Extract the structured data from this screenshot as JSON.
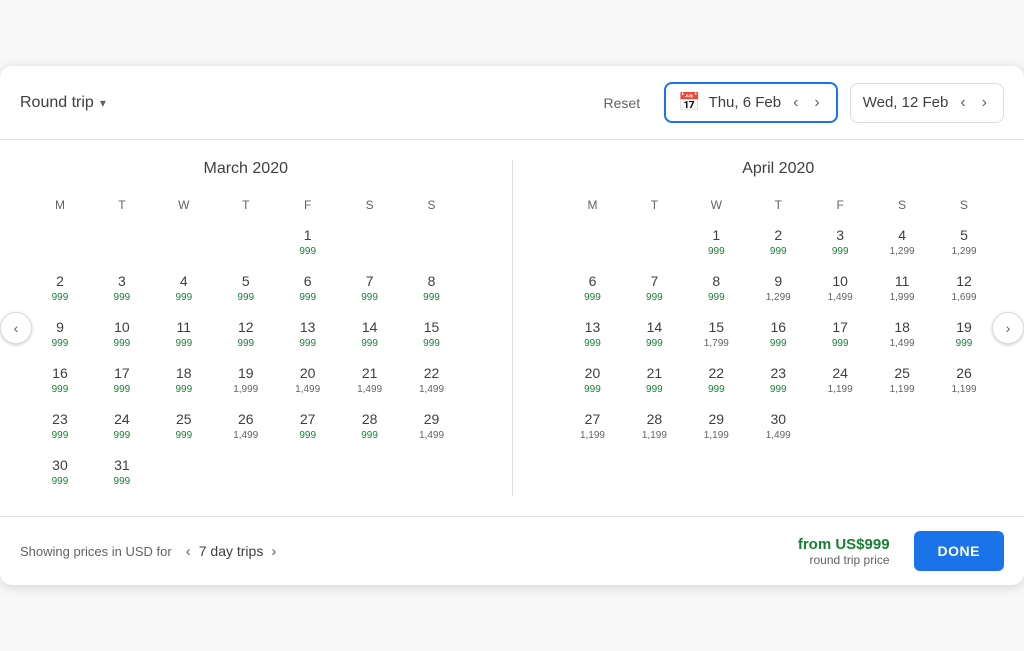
{
  "header": {
    "round_trip_label": "Round trip",
    "chevron_down": "▾",
    "reset_label": "Reset",
    "date1": {
      "icon": "📅",
      "text": "Thu, 6 Feb"
    },
    "date2": {
      "text": "Wed, 12 Feb"
    }
  },
  "left_calendar": {
    "title": "March 2020",
    "day_headers": [
      "M",
      "T",
      "W",
      "T",
      "F",
      "S",
      "S"
    ],
    "rows": [
      [
        {
          "num": "",
          "price": "",
          "green": false
        },
        {
          "num": "",
          "price": "",
          "green": false
        },
        {
          "num": "",
          "price": "",
          "green": false
        },
        {
          "num": "",
          "price": "",
          "green": false
        },
        {
          "num": "1",
          "price": "999",
          "green": true
        },
        {
          "num": "",
          "price": "",
          "green": false
        },
        {
          "num": "",
          "price": "",
          "green": false
        }
      ],
      [
        {
          "num": "2",
          "price": "999",
          "green": true
        },
        {
          "num": "3",
          "price": "999",
          "green": true
        },
        {
          "num": "4",
          "price": "999",
          "green": true
        },
        {
          "num": "5",
          "price": "999",
          "green": true
        },
        {
          "num": "6",
          "price": "999",
          "green": true
        },
        {
          "num": "7",
          "price": "999",
          "green": true
        },
        {
          "num": "8",
          "price": "999",
          "green": true
        }
      ],
      [
        {
          "num": "9",
          "price": "999",
          "green": true
        },
        {
          "num": "10",
          "price": "999",
          "green": true
        },
        {
          "num": "11",
          "price": "999",
          "green": true
        },
        {
          "num": "12",
          "price": "999",
          "green": true
        },
        {
          "num": "13",
          "price": "999",
          "green": true
        },
        {
          "num": "14",
          "price": "999",
          "green": true
        },
        {
          "num": "15",
          "price": "999",
          "green": true
        }
      ],
      [
        {
          "num": "16",
          "price": "999",
          "green": true
        },
        {
          "num": "17",
          "price": "999",
          "green": true
        },
        {
          "num": "18",
          "price": "999",
          "green": true
        },
        {
          "num": "19",
          "price": "1,999",
          "green": false
        },
        {
          "num": "20",
          "price": "1,499",
          "green": false
        },
        {
          "num": "21",
          "price": "1,499",
          "green": false
        },
        {
          "num": "22",
          "price": "1,499",
          "green": false
        }
      ],
      [
        {
          "num": "23",
          "price": "999",
          "green": true
        },
        {
          "num": "24",
          "price": "999",
          "green": true
        },
        {
          "num": "25",
          "price": "999",
          "green": true
        },
        {
          "num": "26",
          "price": "1,499",
          "green": false
        },
        {
          "num": "27",
          "price": "999",
          "green": true
        },
        {
          "num": "28",
          "price": "999",
          "green": true
        },
        {
          "num": "29",
          "price": "1,499",
          "green": false
        }
      ],
      [
        {
          "num": "30",
          "price": "999",
          "green": true
        },
        {
          "num": "31",
          "price": "999",
          "green": true
        },
        {
          "num": "",
          "price": "",
          "green": false
        },
        {
          "num": "",
          "price": "",
          "green": false
        },
        {
          "num": "",
          "price": "",
          "green": false
        },
        {
          "num": "",
          "price": "",
          "green": false
        },
        {
          "num": "",
          "price": "",
          "green": false
        }
      ]
    ]
  },
  "right_calendar": {
    "title": "April 2020",
    "day_headers": [
      "M",
      "T",
      "W",
      "T",
      "F",
      "S",
      "S"
    ],
    "rows": [
      [
        {
          "num": "",
          "price": "",
          "green": false
        },
        {
          "num": "",
          "price": "",
          "green": false
        },
        {
          "num": "1",
          "price": "999",
          "green": true
        },
        {
          "num": "2",
          "price": "999",
          "green": true
        },
        {
          "num": "3",
          "price": "999",
          "green": true
        },
        {
          "num": "4",
          "price": "1,299",
          "green": false
        },
        {
          "num": "5",
          "price": "1,299",
          "green": false
        }
      ],
      [
        {
          "num": "6",
          "price": "999",
          "green": true
        },
        {
          "num": "7",
          "price": "999",
          "green": true
        },
        {
          "num": "8",
          "price": "999",
          "green": true
        },
        {
          "num": "9",
          "price": "1,299",
          "green": false
        },
        {
          "num": "10",
          "price": "1,499",
          "green": false
        },
        {
          "num": "11",
          "price": "1,999",
          "green": false
        },
        {
          "num": "12",
          "price": "1,699",
          "green": false
        }
      ],
      [
        {
          "num": "13",
          "price": "999",
          "green": true
        },
        {
          "num": "14",
          "price": "999",
          "green": true
        },
        {
          "num": "15",
          "price": "1,799",
          "green": false
        },
        {
          "num": "16",
          "price": "999",
          "green": true
        },
        {
          "num": "17",
          "price": "999",
          "green": true
        },
        {
          "num": "18",
          "price": "1,499",
          "green": false
        },
        {
          "num": "19",
          "price": "999",
          "green": true
        }
      ],
      [
        {
          "num": "20",
          "price": "999",
          "green": true
        },
        {
          "num": "21",
          "price": "999",
          "green": true
        },
        {
          "num": "22",
          "price": "999",
          "green": true
        },
        {
          "num": "23",
          "price": "999",
          "green": true
        },
        {
          "num": "24",
          "price": "1,199",
          "green": false
        },
        {
          "num": "25",
          "price": "1,199",
          "green": false
        },
        {
          "num": "26",
          "price": "1,199",
          "green": false
        }
      ],
      [
        {
          "num": "27",
          "price": "1,199",
          "green": false
        },
        {
          "num": "28",
          "price": "1,199",
          "green": false
        },
        {
          "num": "29",
          "price": "1,199",
          "green": false
        },
        {
          "num": "30",
          "price": "1,499",
          "green": false
        },
        {
          "num": "",
          "price": "",
          "green": false
        },
        {
          "num": "",
          "price": "",
          "green": false
        },
        {
          "num": "",
          "price": "",
          "green": false
        }
      ]
    ]
  },
  "footer": {
    "showing_text": "Showing prices in USD for",
    "trip_label": "7 day trips",
    "price_from": "from US$999",
    "price_sub": "round trip price",
    "done_label": "DONE"
  }
}
